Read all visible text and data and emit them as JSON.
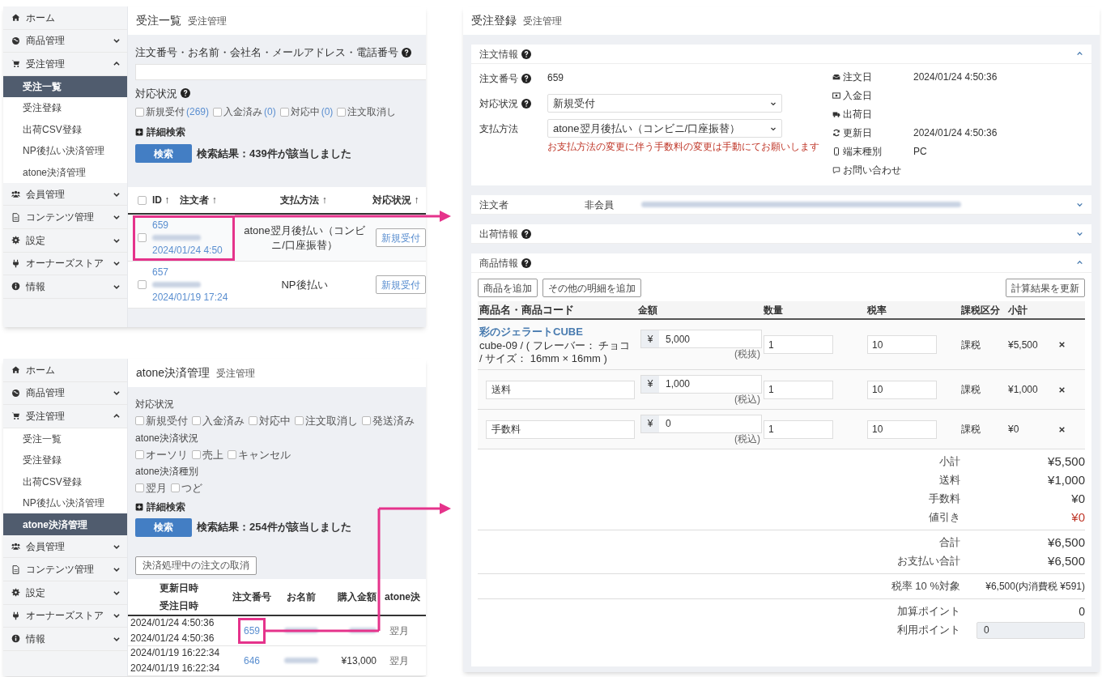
{
  "order_list": {
    "title": "受注一覧",
    "breadcrumb": "受注管理",
    "sidebar": {
      "items": [
        {
          "label": "ホーム"
        },
        {
          "label": "商品管理",
          "expanded": false
        },
        {
          "label": "受注管理",
          "expanded": true,
          "children": [
            {
              "label": "受注一覧",
              "selected": true
            },
            {
              "label": "受注登録",
              "selected": false
            },
            {
              "label": "出荷CSV登録",
              "selected": false
            },
            {
              "label": "NP後払い決済管理",
              "selected": false
            },
            {
              "label": "atone決済管理",
              "selected": false
            }
          ]
        },
        {
          "label": "会員管理",
          "expanded": false
        },
        {
          "label": "コンテンツ管理",
          "expanded": false
        },
        {
          "label": "設定",
          "expanded": false
        },
        {
          "label": "オーナーズストア",
          "expanded": false
        },
        {
          "label": "情報",
          "expanded": false
        }
      ]
    },
    "search_label": "注文番号・お名前・会社名・メールアドレス・電話番号",
    "status_label": "対応状況",
    "status_filters": [
      {
        "label": "新規受付",
        "count": "(269)",
        "checked": false
      },
      {
        "label": "入金済み",
        "count": "(0)",
        "checked": false
      },
      {
        "label": "対応中",
        "count": "(0)",
        "checked": false
      },
      {
        "label": "注文取消し",
        "checked": false
      }
    ],
    "advanced_search": "詳細検索",
    "search_button": "検索",
    "result": "検索結果：439件が該当しました",
    "select_all": {
      "checked": false
    },
    "columns": [
      "ID ↑",
      "注文者 ↑",
      "支払方法 ↑",
      "対応状況 ↑"
    ],
    "rows": [
      {
        "id": "659",
        "date": "2024/01/24 4:50",
        "payment": "atone翌月後払い（コンビニ/口座振替）",
        "status": "新規受付",
        "checked": false,
        "highlighted": true
      },
      {
        "id": "657",
        "date": "2024/01/19 17:24",
        "payment": "NP後払い",
        "status": "新規受付",
        "checked": false,
        "highlighted": false
      }
    ]
  },
  "atone_list": {
    "title": "atone決済管理",
    "breadcrumb": "受注管理",
    "sidebar": {
      "items": [
        {
          "label": "ホーム"
        },
        {
          "label": "商品管理",
          "expanded": false
        },
        {
          "label": "受注管理",
          "expanded": true,
          "children": [
            {
              "label": "受注一覧",
              "selected": false
            },
            {
              "label": "受注登録",
              "selected": false
            },
            {
              "label": "出荷CSV登録",
              "selected": false
            },
            {
              "label": "NP後払い決済管理",
              "selected": false
            },
            {
              "label": "atone決済管理",
              "selected": true
            }
          ]
        },
        {
          "label": "会員管理",
          "expanded": false
        },
        {
          "label": "コンテンツ管理",
          "expanded": false
        },
        {
          "label": "設定",
          "expanded": false
        },
        {
          "label": "オーナーズストア",
          "expanded": false
        },
        {
          "label": "情報",
          "expanded": false
        }
      ]
    },
    "filter_groups": [
      {
        "label": "対応状況",
        "options": [
          {
            "label": "新規受付",
            "checked": false
          },
          {
            "label": "入金済み",
            "checked": false
          },
          {
            "label": "対応中",
            "checked": false
          },
          {
            "label": "注文取消し",
            "checked": false
          },
          {
            "label": "発送済み",
            "checked": false
          }
        ]
      },
      {
        "label": "atone決済状況",
        "options": [
          {
            "label": "オーソリ",
            "checked": false
          },
          {
            "label": "売上",
            "checked": false
          },
          {
            "label": "キャンセル",
            "checked": false
          }
        ]
      },
      {
        "label": "atone決済種別",
        "options": [
          {
            "label": "翌月",
            "checked": false
          },
          {
            "label": "つど",
            "checked": false
          }
        ]
      }
    ],
    "advanced_search": "詳細検索",
    "search_button": "検索",
    "result": "検索結果：254件が該当しました",
    "cancel_button": "決済処理中の注文の取消",
    "columns": [
      [
        "更新日時",
        "受注日時"
      ],
      [
        "注文番号"
      ],
      [
        "お名前"
      ],
      [
        "購入金額"
      ],
      [
        "atone決"
      ]
    ],
    "rows": [
      {
        "updated": "2024/01/24 4:50:36",
        "ordered": "2024/01/24 4:50:36",
        "order_no": "659",
        "type": "翌月",
        "highlighted": true
      },
      {
        "updated": "2024/01/19 16:22:34",
        "ordered": "2024/01/19 16:22:34",
        "order_no": "646",
        "amount": "¥13,000",
        "type": "翌月",
        "highlighted": false
      }
    ]
  },
  "order_edit": {
    "title": "受注登録",
    "breadcrumb": "受注管理",
    "order_info": {
      "title": "注文情報",
      "expanded": true,
      "left": [
        {
          "label": "注文番号",
          "help": true,
          "kind": "text",
          "value": "659"
        },
        {
          "label": "対応状況",
          "help": true,
          "kind": "select",
          "value": "新規受付"
        },
        {
          "label": "支払方法",
          "help": false,
          "kind": "select",
          "value": "atone翌月後払い（コンビニ/口座振替）",
          "note": "お支払方法の変更に伴う手数料の変更は手動にてお願いします"
        }
      ],
      "right": [
        {
          "label": "注文日",
          "value": "2024/01/24 4:50:36"
        },
        {
          "label": "入金日"
        },
        {
          "label": "出荷日"
        },
        {
          "label": "更新日",
          "value": "2024/01/24 4:50:36"
        },
        {
          "label": "端末種別",
          "value": "PC"
        },
        {
          "label": "お問い合わせ"
        }
      ]
    },
    "customer": {
      "title": "注文者",
      "value": "非会員",
      "expanded": false
    },
    "shipping": {
      "title": "出荷情報",
      "expanded": false
    },
    "products": {
      "title": "商品情報",
      "expanded": true,
      "buttons": [
        "商品を追加",
        "その他の明細を追加"
      ],
      "update_button": "計算結果を更新",
      "columns": [
        "商品名・商品コード",
        "金額",
        "数量",
        "税率",
        "課税区分",
        "小計"
      ],
      "rows": [
        {
          "kind": "product",
          "name": "彩のジェラートCUBE",
          "code": "cube-09 / ( フレーバー： チョコ / サイズ： 16mm × 16mm )",
          "currency": "¥",
          "price": "5,000",
          "tax_note": "(税抜)",
          "quantity": "1",
          "tax_rate": "10",
          "tax_class": "課税",
          "subtotal": "¥5,500"
        },
        {
          "kind": "line",
          "name": "送料",
          "currency": "¥",
          "price": "1,000",
          "tax_note": "(税込)",
          "quantity": "1",
          "tax_rate": "10",
          "tax_class": "課税",
          "subtotal": "¥1,000"
        },
        {
          "kind": "line",
          "name": "手数料",
          "currency": "¥",
          "price": "0",
          "tax_note": "(税込)",
          "quantity": "1",
          "tax_rate": "10",
          "tax_class": "課税",
          "subtotal": "¥0"
        }
      ],
      "summary": [
        [
          {
            "label": "小計",
            "value": "¥5,500",
            "kind": "amount"
          },
          {
            "label": "送料",
            "value": "¥1,000",
            "kind": "amount"
          },
          {
            "label": "手数料",
            "value": "¥0",
            "kind": "amount"
          },
          {
            "label": "値引き",
            "value": "¥0",
            "kind": "discount"
          }
        ],
        [
          {
            "label": "合計",
            "value": "¥6,500",
            "kind": "amount"
          },
          {
            "label": "お支払い合計",
            "value": "¥6,500",
            "kind": "amount"
          }
        ],
        [
          {
            "label": "税率 10 %対象",
            "value": "¥6,500(内消費税 ¥591)",
            "kind": "small"
          }
        ],
        [
          {
            "label": "加算ポイント",
            "value": "0",
            "kind": "points"
          },
          {
            "label": "利用ポイント",
            "value": "0",
            "kind": "input"
          }
        ]
      ]
    }
  }
}
